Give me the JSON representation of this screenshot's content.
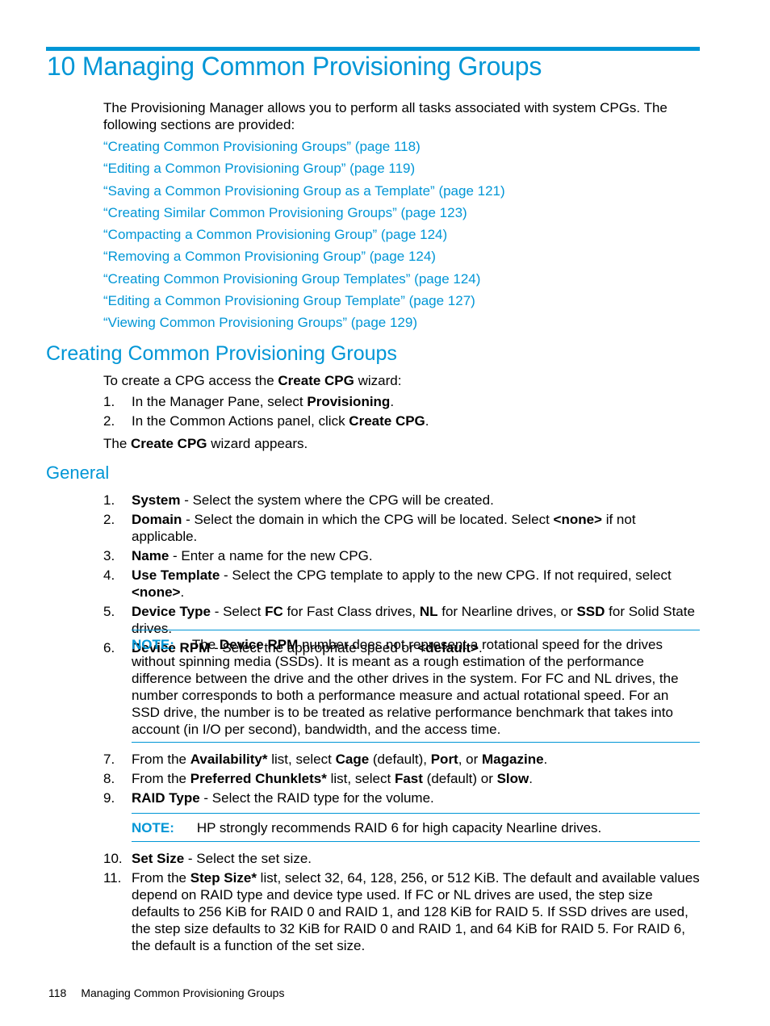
{
  "chapter": {
    "title": "10 Managing Common Provisioning Groups",
    "intro": "The Provisioning Manager allows you to perform all tasks associated with system CPGs. The following sections are provided:",
    "toc_links": [
      "“Creating Common Provisioning Groups” (page 118)",
      "“Editing a Common Provisioning Group” (page 119)",
      "“Saving a Common Provisioning Group as a Template” (page 121)",
      "“Creating Similar Common Provisioning Groups” (page 123)",
      "“Compacting a Common Provisioning Group” (page 124)",
      "“Removing a Common Provisioning Group” (page 124)",
      "“Creating Common Provisioning Group Templates” (page 124)",
      "“Editing a Common Provisioning Group Template” (page 127)",
      "“Viewing Common Provisioning Groups” (page 129)"
    ]
  },
  "section": {
    "heading": "Creating Common Provisioning Groups",
    "lead": {
      "pre": "To create a CPG access the ",
      "bold": "Create CPG",
      "post": " wizard:"
    },
    "steps": [
      {
        "num": "1.",
        "pre": "In the Manager Pane, select ",
        "bold": "Provisioning",
        "post": "."
      },
      {
        "num": "2.",
        "pre": "In the Common Actions panel, click ",
        "bold": "Create CPG",
        "post": "."
      }
    ],
    "result": {
      "pre": "The ",
      "bold": "Create CPG",
      "post": " wizard appears."
    }
  },
  "general": {
    "heading": "General",
    "items_a": [
      {
        "num": "1.",
        "term": "System",
        "text": " - Select the system where the CPG will be created."
      },
      {
        "num": "2.",
        "term": "Domain",
        "text": " - Select the domain in which the CPG will be located. Select ",
        "bold2": "<none>",
        "text2": " if not applicable."
      },
      {
        "num": "3.",
        "term": "Name",
        "text": " - Enter a name for the new CPG."
      },
      {
        "num": "4.",
        "term": "Use Template",
        "text": " - Select the CPG template to apply to the new CPG. If not required, select ",
        "bold2": "<none>",
        "text2": "."
      },
      {
        "num": "5.",
        "term": "Device Type",
        "text": " - Select ",
        "bold2": "FC",
        "text2": " for Fast Class drives, ",
        "bold3": "NL",
        "text3": " for Nearline drives, or ",
        "bold4": "SSD",
        "text4": " for Solid State drives."
      },
      {
        "num": "6.",
        "term": "Device RPM",
        "text": " - Select the appropriate speed or ",
        "bold2": "<default>",
        "text2": "."
      }
    ],
    "note1": {
      "label": "NOTE:",
      "pre": "The ",
      "bold": "Device RPM",
      "post": " number does not represent a rotational speed for the drives without spinning media (SSDs). It is meant as a rough estimation of the performance difference between the drive and the other drives in the system. For FC and NL drives, the number corresponds to both a performance measure and actual rotational speed. For an SSD drive, the number is to be treated as relative performance benchmark that takes into account (in I/O per second), bandwidth, and the access time."
    },
    "items_b": [
      {
        "num": "7.",
        "t1": "From the ",
        "b1": "Availability*",
        "t2": " list, select ",
        "b2": "Cage",
        "t3": " (default), ",
        "b3": "Port",
        "t4": ", or ",
        "b4": "Magazine",
        "t5": "."
      },
      {
        "num": "8.",
        "t1": "From the ",
        "b1": "Preferred Chunklets*",
        "t2": " list, select ",
        "b2": "Fast",
        "t3": " (default) or ",
        "b3": "Slow",
        "t4": "."
      },
      {
        "num": "9.",
        "b1": "RAID Type",
        "t2": " - Select the RAID type for the volume."
      }
    ],
    "note2": {
      "label": "NOTE:",
      "text": "HP strongly recommends RAID 6 for high capacity Nearline drives."
    },
    "items_c": [
      {
        "num": "10.",
        "b1": "Set Size",
        "t2": " - Select the set size."
      },
      {
        "num": "11.",
        "t1": "From the ",
        "b1": "Step Size*",
        "t2": " list, select 32, 64, 128, 256, or 512 KiB. The default and available values depend on RAID type and device type used. If FC or NL drives are used, the step size defaults to 256 KiB for RAID 0 and RAID 1, and 128 KiB for RAID 5. If SSD drives are used, the step size defaults to 32 KiB for RAID 0 and RAID 1, and 64 KiB for RAID 5. For RAID 6, the default is a function of the set size."
      }
    ]
  },
  "footer": {
    "page_number": "118",
    "running_title": "Managing Common Provisioning Groups"
  }
}
